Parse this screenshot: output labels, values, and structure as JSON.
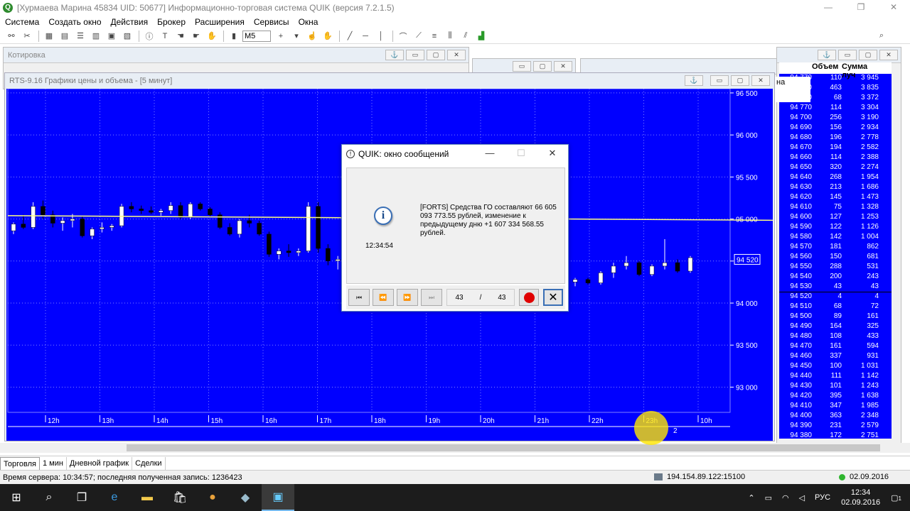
{
  "window": {
    "title": "[Хурмаева Марина 45834 UID: 50677] Информационно-торговая система QUIK (версия 7.2.1.5)",
    "app_icon": "Q",
    "controls": [
      "—",
      "❐",
      "✕"
    ]
  },
  "menu": [
    "Система",
    "Создать окно",
    "Действия",
    "Брокер",
    "Расширения",
    "Сервисы",
    "Окна"
  ],
  "toolbar": {
    "interval": "M5"
  },
  "bg_windows": {
    "quotes_title": "Котировка",
    "anchor": "⚓"
  },
  "chart": {
    "title": "RTS-9.16 Графики цены и объема - [5 минут]",
    "price_label": "94 520",
    "bar_counter": "2",
    "colors": {
      "background": "#0000ff",
      "grid": "#8080ff",
      "candle_up": "#ffffff",
      "candle_down": "#000000",
      "ma": "#ffff80"
    }
  },
  "chart_data": {
    "type": "candlestick",
    "title": "RTS-9.16 Графики цены и объема - [5 минут]",
    "y_ticks": [
      96500,
      96000,
      95500,
      95000,
      94500,
      94000,
      93500,
      93000
    ],
    "y_tick_labels": [
      "96 500",
      "96 000",
      "95 500",
      "95 000",
      "94 500",
      "94 000",
      "93 500",
      "93 000"
    ],
    "ylim": [
      92700,
      96550
    ],
    "x_labels": [
      "12h",
      "13h",
      "14h",
      "15h",
      "16h",
      "17h",
      "18h",
      "19h",
      "20h",
      "21h",
      "22h",
      "23h",
      "10h"
    ],
    "current_price": 94520,
    "ma_line": [
      [
        0,
        95040
      ],
      [
        55,
        94980
      ],
      [
        78,
        94620
      ]
    ],
    "candles": [
      [
        94860,
        94960,
        94820,
        94940
      ],
      [
        94940,
        95050,
        94880,
        94900
      ],
      [
        94900,
        95200,
        94880,
        95150
      ],
      [
        95150,
        95220,
        95000,
        95050
      ],
      [
        95050,
        95100,
        94900,
        94950
      ],
      [
        94950,
        95020,
        94860,
        94980
      ],
      [
        94980,
        95060,
        94900,
        95000
      ],
      [
        95000,
        95040,
        94780,
        94800
      ],
      [
        94800,
        94900,
        94760,
        94880
      ],
      [
        94880,
        94960,
        94840,
        94900
      ],
      [
        94900,
        94940,
        94860,
        94920
      ],
      [
        94920,
        95180,
        94900,
        95150
      ],
      [
        95150,
        95200,
        95080,
        95120
      ],
      [
        95120,
        95160,
        95060,
        95100
      ],
      [
        95100,
        95150,
        95060,
        95080
      ],
      [
        95080,
        95120,
        95040,
        95100
      ],
      [
        95100,
        95200,
        95060,
        95160
      ],
      [
        95160,
        95200,
        95000,
        95020
      ],
      [
        95020,
        95200,
        95000,
        95180
      ],
      [
        95180,
        95200,
        95100,
        95120
      ],
      [
        95120,
        95140,
        95020,
        95050
      ],
      [
        95050,
        95080,
        94880,
        94900
      ],
      [
        94900,
        94950,
        94800,
        94820
      ],
      [
        94820,
        95000,
        94780,
        94980
      ],
      [
        94980,
        95050,
        94900,
        94950
      ],
      [
        94950,
        94980,
        94800,
        94820
      ],
      [
        94820,
        94850,
        94550,
        94580
      ],
      [
        94580,
        94650,
        94520,
        94620
      ],
      [
        94620,
        94700,
        94550,
        94600
      ],
      [
        94600,
        94650,
        94560,
        94620
      ],
      [
        94620,
        95200,
        94600,
        95150
      ],
      [
        95150,
        95200,
        94600,
        94650
      ],
      [
        94650,
        94700,
        94450,
        94500
      ],
      [
        94500,
        94560,
        94400,
        94520
      ],
      [
        94250,
        94300,
        94200,
        94280
      ],
      [
        94280,
        94300,
        94220,
        94240
      ],
      [
        94240,
        94380,
        94220,
        94360
      ],
      [
        94360,
        94480,
        94300,
        94440
      ],
      [
        94440,
        94560,
        94400,
        94480
      ],
      [
        94480,
        94500,
        94320,
        94340
      ],
      [
        94340,
        94460,
        94320,
        94440
      ],
      [
        94440,
        94760,
        94400,
        94480
      ],
      [
        94480,
        94520,
        94360,
        94380
      ],
      [
        94380,
        94560,
        94360,
        94540
      ]
    ]
  },
  "quotes": {
    "headers": [
      "",
      "Объем",
      "Сумма луч"
    ],
    "partial_label": "на",
    "rows": [
      [
        "94 770",
        "110",
        "3 945"
      ],
      [
        "94 760",
        "463",
        "3 835"
      ],
      [
        "94 750",
        "68",
        "3 372"
      ],
      [
        "94 770",
        "114",
        "3 304"
      ],
      [
        "94 700",
        "256",
        "3 190"
      ],
      [
        "94 690",
        "156",
        "2 934"
      ],
      [
        "94 680",
        "196",
        "2 778"
      ],
      [
        "94 670",
        "194",
        "2 582"
      ],
      [
        "94 660",
        "114",
        "2 388"
      ],
      [
        "94 650",
        "320",
        "2 274"
      ],
      [
        "94 640",
        "268",
        "1 954"
      ],
      [
        "94 630",
        "213",
        "1 686"
      ],
      [
        "94 620",
        "145",
        "1 473"
      ],
      [
        "94 610",
        "75",
        "1 328"
      ],
      [
        "94 600",
        "127",
        "1 253"
      ],
      [
        "94 590",
        "122",
        "1 126"
      ],
      [
        "94 580",
        "142",
        "1 004"
      ],
      [
        "94 570",
        "181",
        "862"
      ],
      [
        "94 560",
        "150",
        "681"
      ],
      [
        "94 550",
        "288",
        "531"
      ],
      [
        "94 540",
        "200",
        "243"
      ],
      [
        "94 530",
        "43",
        "43"
      ],
      [
        "94 520",
        "4",
        "4"
      ],
      [
        "94 510",
        "68",
        "72"
      ],
      [
        "94 500",
        "89",
        "161"
      ],
      [
        "94 490",
        "164",
        "325"
      ],
      [
        "94 480",
        "108",
        "433"
      ],
      [
        "94 470",
        "161",
        "594"
      ],
      [
        "94 460",
        "337",
        "931"
      ],
      [
        "94 450",
        "100",
        "1 031"
      ],
      [
        "94 440",
        "111",
        "1 142"
      ],
      [
        "94 430",
        "101",
        "1 243"
      ],
      [
        "94 420",
        "395",
        "1 638"
      ],
      [
        "94 410",
        "347",
        "1 985"
      ],
      [
        "94 400",
        "363",
        "2 348"
      ],
      [
        "94 390",
        "231",
        "2 579"
      ],
      [
        "94 380",
        "172",
        "2 751"
      ]
    ]
  },
  "dialog": {
    "title": "QUIK: окно сообщений",
    "time": "12:34:54",
    "message": "[FORTS] Средства ГО составляют 66 605 093 773.55 рублей, изменение к предыдущему дню +1 607 334 568.55 рублей.",
    "counter_current": "43",
    "counter_sep": "/",
    "counter_total": "43",
    "nav": [
      "⏮",
      "⏪",
      "⏩",
      "⏭"
    ]
  },
  "tabs": [
    "Торговля",
    "1 мин",
    "Дневной график",
    "Сделки"
  ],
  "status": {
    "server": "Время сервера: 10:34:57; последняя полученная запись: 1236423",
    "ip": "194.154.89.122:15100",
    "date": "02.09.2016"
  },
  "taskbar": {
    "lang": "РУС",
    "time": "12:34",
    "date": "02.09.2016",
    "notif": "1"
  }
}
